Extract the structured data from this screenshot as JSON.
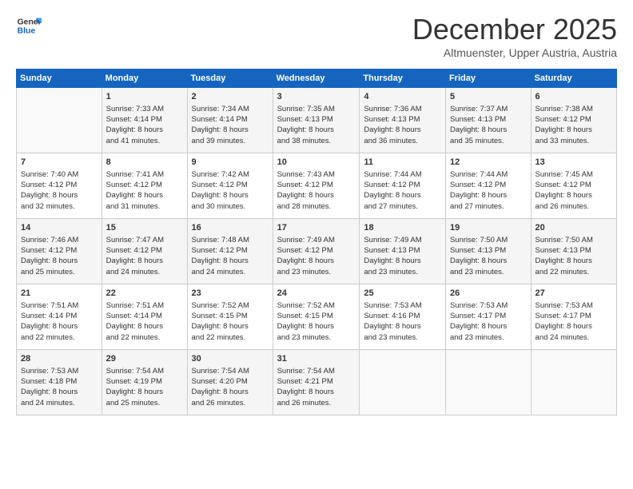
{
  "header": {
    "title": "December 2025",
    "subtitle": "Altmuenster, Upper Austria, Austria"
  },
  "calendar": {
    "days": [
      "Sunday",
      "Monday",
      "Tuesday",
      "Wednesday",
      "Thursday",
      "Friday",
      "Saturday"
    ]
  },
  "weeks": [
    [
      {
        "num": "",
        "info": ""
      },
      {
        "num": "1",
        "info": "Sunrise: 7:33 AM\nSunset: 4:14 PM\nDaylight: 8 hours\nand 41 minutes."
      },
      {
        "num": "2",
        "info": "Sunrise: 7:34 AM\nSunset: 4:14 PM\nDaylight: 8 hours\nand 39 minutes."
      },
      {
        "num": "3",
        "info": "Sunrise: 7:35 AM\nSunset: 4:13 PM\nDaylight: 8 hours\nand 38 minutes."
      },
      {
        "num": "4",
        "info": "Sunrise: 7:36 AM\nSunset: 4:13 PM\nDaylight: 8 hours\nand 36 minutes."
      },
      {
        "num": "5",
        "info": "Sunrise: 7:37 AM\nSunset: 4:13 PM\nDaylight: 8 hours\nand 35 minutes."
      },
      {
        "num": "6",
        "info": "Sunrise: 7:38 AM\nSunset: 4:12 PM\nDaylight: 8 hours\nand 33 minutes."
      }
    ],
    [
      {
        "num": "7",
        "info": "Sunrise: 7:40 AM\nSunset: 4:12 PM\nDaylight: 8 hours\nand 32 minutes."
      },
      {
        "num": "8",
        "info": "Sunrise: 7:41 AM\nSunset: 4:12 PM\nDaylight: 8 hours\nand 31 minutes."
      },
      {
        "num": "9",
        "info": "Sunrise: 7:42 AM\nSunset: 4:12 PM\nDaylight: 8 hours\nand 30 minutes."
      },
      {
        "num": "10",
        "info": "Sunrise: 7:43 AM\nSunset: 4:12 PM\nDaylight: 8 hours\nand 28 minutes."
      },
      {
        "num": "11",
        "info": "Sunrise: 7:44 AM\nSunset: 4:12 PM\nDaylight: 8 hours\nand 27 minutes."
      },
      {
        "num": "12",
        "info": "Sunrise: 7:44 AM\nSunset: 4:12 PM\nDaylight: 8 hours\nand 27 minutes."
      },
      {
        "num": "13",
        "info": "Sunrise: 7:45 AM\nSunset: 4:12 PM\nDaylight: 8 hours\nand 26 minutes."
      }
    ],
    [
      {
        "num": "14",
        "info": "Sunrise: 7:46 AM\nSunset: 4:12 PM\nDaylight: 8 hours\nand 25 minutes."
      },
      {
        "num": "15",
        "info": "Sunrise: 7:47 AM\nSunset: 4:12 PM\nDaylight: 8 hours\nand 24 minutes."
      },
      {
        "num": "16",
        "info": "Sunrise: 7:48 AM\nSunset: 4:12 PM\nDaylight: 8 hours\nand 24 minutes."
      },
      {
        "num": "17",
        "info": "Sunrise: 7:49 AM\nSunset: 4:12 PM\nDaylight: 8 hours\nand 23 minutes."
      },
      {
        "num": "18",
        "info": "Sunrise: 7:49 AM\nSunset: 4:13 PM\nDaylight: 8 hours\nand 23 minutes."
      },
      {
        "num": "19",
        "info": "Sunrise: 7:50 AM\nSunset: 4:13 PM\nDaylight: 8 hours\nand 23 minutes."
      },
      {
        "num": "20",
        "info": "Sunrise: 7:50 AM\nSunset: 4:13 PM\nDaylight: 8 hours\nand 22 minutes."
      }
    ],
    [
      {
        "num": "21",
        "info": "Sunrise: 7:51 AM\nSunset: 4:14 PM\nDaylight: 8 hours\nand 22 minutes."
      },
      {
        "num": "22",
        "info": "Sunrise: 7:51 AM\nSunset: 4:14 PM\nDaylight: 8 hours\nand 22 minutes."
      },
      {
        "num": "23",
        "info": "Sunrise: 7:52 AM\nSunset: 4:15 PM\nDaylight: 8 hours\nand 22 minutes."
      },
      {
        "num": "24",
        "info": "Sunrise: 7:52 AM\nSunset: 4:15 PM\nDaylight: 8 hours\nand 23 minutes."
      },
      {
        "num": "25",
        "info": "Sunrise: 7:53 AM\nSunset: 4:16 PM\nDaylight: 8 hours\nand 23 minutes."
      },
      {
        "num": "26",
        "info": "Sunrise: 7:53 AM\nSunset: 4:17 PM\nDaylight: 8 hours\nand 23 minutes."
      },
      {
        "num": "27",
        "info": "Sunrise: 7:53 AM\nSunset: 4:17 PM\nDaylight: 8 hours\nand 24 minutes."
      }
    ],
    [
      {
        "num": "28",
        "info": "Sunrise: 7:53 AM\nSunset: 4:18 PM\nDaylight: 8 hours\nand 24 minutes."
      },
      {
        "num": "29",
        "info": "Sunrise: 7:54 AM\nSunset: 4:19 PM\nDaylight: 8 hours\nand 25 minutes."
      },
      {
        "num": "30",
        "info": "Sunrise: 7:54 AM\nSunset: 4:20 PM\nDaylight: 8 hours\nand 26 minutes."
      },
      {
        "num": "31",
        "info": "Sunrise: 7:54 AM\nSunset: 4:21 PM\nDaylight: 8 hours\nand 26 minutes."
      },
      {
        "num": "",
        "info": ""
      },
      {
        "num": "",
        "info": ""
      },
      {
        "num": "",
        "info": ""
      }
    ]
  ]
}
